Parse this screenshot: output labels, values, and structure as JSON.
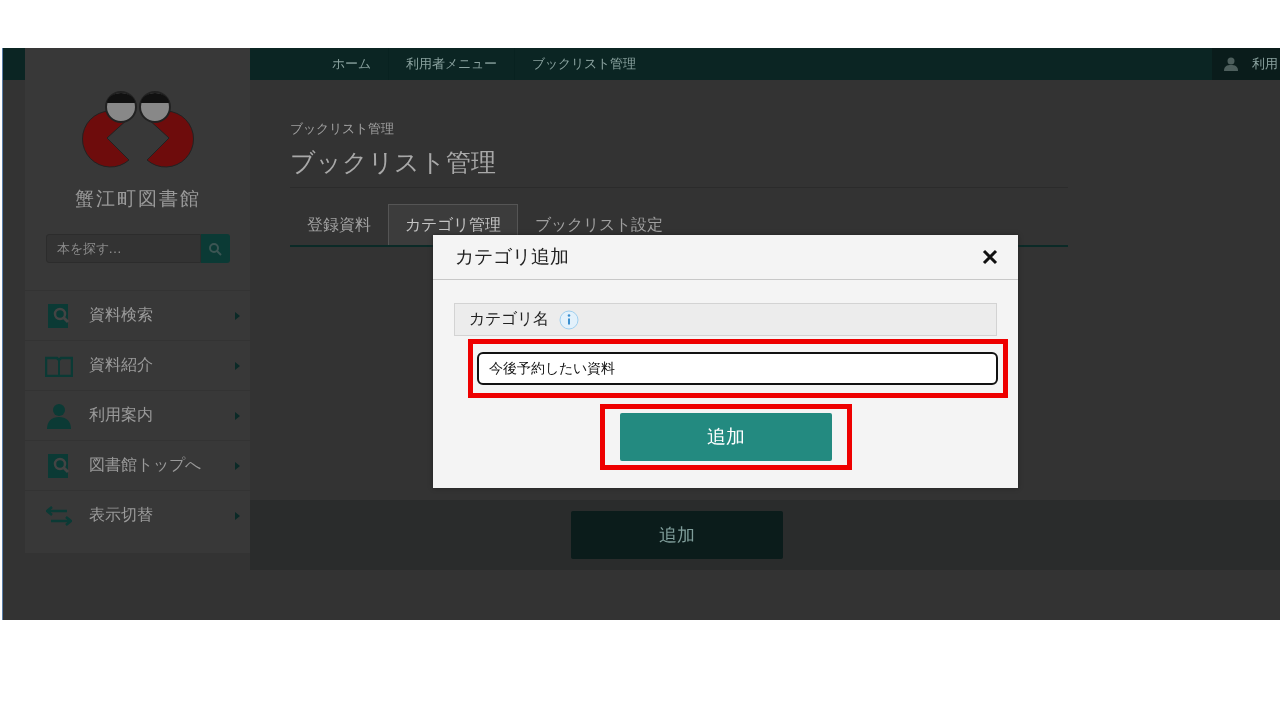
{
  "top_nav": {
    "breadcrumbs": [
      "ホーム",
      "利用者メニュー",
      "ブックリスト管理"
    ],
    "user_menu": "利用"
  },
  "sidebar": {
    "library_name": "蟹江町図書館",
    "search": {
      "placeholder": "本を探す…"
    },
    "menu": [
      {
        "label": "資料検索",
        "kind": "search-book"
      },
      {
        "label": "資料紹介",
        "kind": "open-book"
      },
      {
        "label": "利用案内",
        "kind": "person"
      },
      {
        "label": "図書館トップへ",
        "kind": "search-book"
      },
      {
        "label": "表示切替",
        "kind": "swap"
      }
    ]
  },
  "page": {
    "breadcrumb": "ブックリスト管理",
    "title": "ブックリスト管理",
    "tabs": [
      {
        "label": "登録資料",
        "selected": false
      },
      {
        "label": "カテゴリ管理",
        "selected": true
      },
      {
        "label": "ブックリスト設定",
        "selected": false
      }
    ],
    "footer_button": "追加"
  },
  "dialog": {
    "title": "カテゴリ追加",
    "field_label": "カテゴリ名",
    "field_value": "今後予約したい資料",
    "field_highlighted": true,
    "submit": "追加",
    "submit_highlighted": true
  }
}
